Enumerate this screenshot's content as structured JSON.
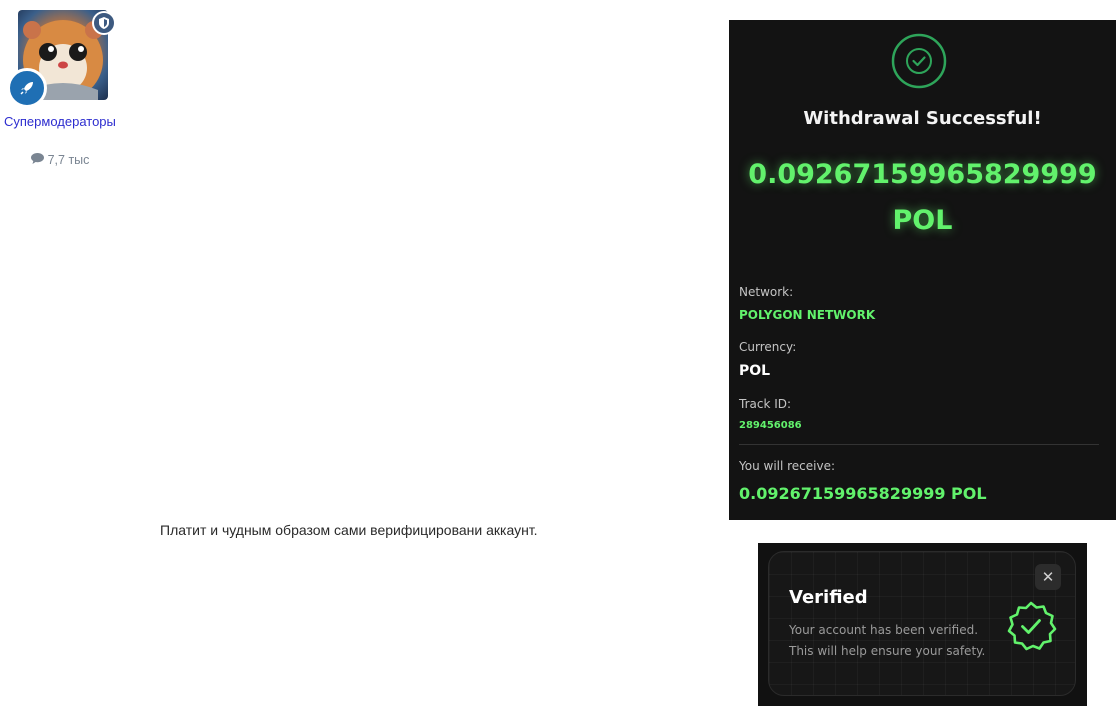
{
  "profile": {
    "group_name": "Супермодераторы",
    "post_count": "7,7 тыс"
  },
  "post": {
    "text": "Платит и чудным образом сами верифицировани аккаунт."
  },
  "withdrawal": {
    "title": "Withdrawal Successful!",
    "amount": "0.09267159965829999",
    "unit": "POL",
    "network_label": "Network:",
    "network_value": "POLYGON NETWORK",
    "currency_label": "Currency:",
    "currency_value": "POL",
    "track_label": "Track ID:",
    "track_value": "289456086",
    "receive_label": "You will receive:",
    "receive_value": "0.09267159965829999 POL"
  },
  "verified": {
    "title": "Verified",
    "line1": "Your account has been verified.",
    "line2": "This will help ensure your safety.",
    "close_glyph": "✕"
  },
  "colors": {
    "accent_green": "#62f26c",
    "link_blue": "#2d2dcf",
    "badge_blue": "#1f6fb4"
  }
}
